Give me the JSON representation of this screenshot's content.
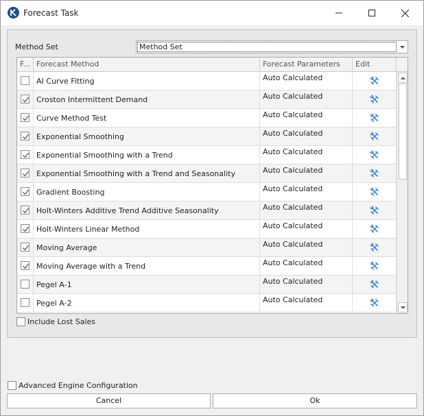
{
  "window": {
    "title": "Forecast Task"
  },
  "method_set": {
    "label": "Method Set",
    "value": "Method Set"
  },
  "grid": {
    "headers": {
      "check": "F...",
      "method": "Forecast Method",
      "params": "Forecast Parameters",
      "edit": "Edit"
    },
    "rows": [
      {
        "checked": false,
        "method": "AI Curve Fitting",
        "params": "Auto Calculated"
      },
      {
        "checked": true,
        "method": "Croston Intermittent Demand",
        "params": "Auto Calculated"
      },
      {
        "checked": true,
        "method": "Curve Method Test",
        "params": "Auto Calculated"
      },
      {
        "checked": true,
        "method": "Exponential Smoothing",
        "params": "Auto Calculated"
      },
      {
        "checked": true,
        "method": "Exponential Smoothing with a Trend",
        "params": "Auto Calculated"
      },
      {
        "checked": true,
        "method": "Exponential Smoothing with a Trend and Seasonality",
        "params": "Auto Calculated"
      },
      {
        "checked": true,
        "method": "Gradient Boosting",
        "params": "Auto Calculated"
      },
      {
        "checked": true,
        "method": "Holt-Winters Additive Trend Additive Seasonality",
        "params": "Auto Calculated"
      },
      {
        "checked": true,
        "method": "Holt-Winters Linear Method",
        "params": "Auto Calculated"
      },
      {
        "checked": true,
        "method": "Moving Average",
        "params": "Auto Calculated"
      },
      {
        "checked": true,
        "method": "Moving Average with a Trend",
        "params": "Auto Calculated"
      },
      {
        "checked": false,
        "method": "Pegel A-1",
        "params": "Auto Calculated"
      },
      {
        "checked": false,
        "method": "Pegel A-2",
        "params": "Auto Calculated"
      }
    ]
  },
  "include_lost_sales": {
    "label": "Include Lost Sales",
    "checked": false
  },
  "advanced_engine": {
    "label": "Advanced Engine Configuration",
    "checked": false
  },
  "buttons": {
    "cancel": "Cancel",
    "ok": "Ok"
  },
  "colors": {
    "accent": "#1f6fc8",
    "titlebar": "#ffffff",
    "panel": "#e8e8e8"
  },
  "icons": {
    "edit": "tools-icon",
    "app": "app-logo-icon"
  }
}
